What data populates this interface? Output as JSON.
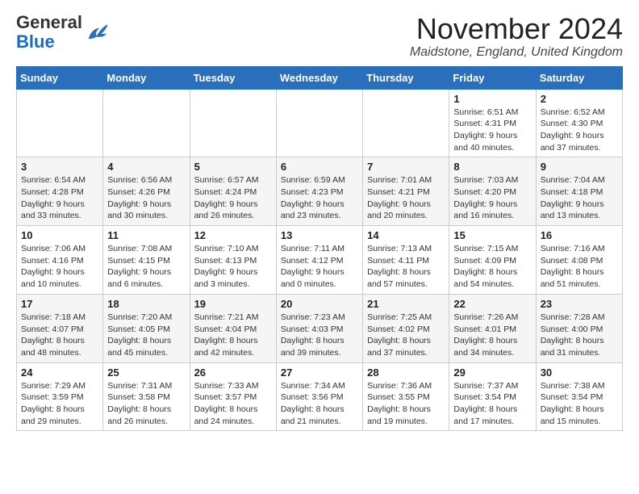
{
  "logo": {
    "general": "General",
    "blue": "Blue"
  },
  "title": "November 2024",
  "subtitle": "Maidstone, England, United Kingdom",
  "days_of_week": [
    "Sunday",
    "Monday",
    "Tuesday",
    "Wednesday",
    "Thursday",
    "Friday",
    "Saturday"
  ],
  "weeks": [
    [
      {
        "day": "",
        "info": ""
      },
      {
        "day": "",
        "info": ""
      },
      {
        "day": "",
        "info": ""
      },
      {
        "day": "",
        "info": ""
      },
      {
        "day": "",
        "info": ""
      },
      {
        "day": "1",
        "info": "Sunrise: 6:51 AM\nSunset: 4:31 PM\nDaylight: 9 hours and 40 minutes."
      },
      {
        "day": "2",
        "info": "Sunrise: 6:52 AM\nSunset: 4:30 PM\nDaylight: 9 hours and 37 minutes."
      }
    ],
    [
      {
        "day": "3",
        "info": "Sunrise: 6:54 AM\nSunset: 4:28 PM\nDaylight: 9 hours and 33 minutes."
      },
      {
        "day": "4",
        "info": "Sunrise: 6:56 AM\nSunset: 4:26 PM\nDaylight: 9 hours and 30 minutes."
      },
      {
        "day": "5",
        "info": "Sunrise: 6:57 AM\nSunset: 4:24 PM\nDaylight: 9 hours and 26 minutes."
      },
      {
        "day": "6",
        "info": "Sunrise: 6:59 AM\nSunset: 4:23 PM\nDaylight: 9 hours and 23 minutes."
      },
      {
        "day": "7",
        "info": "Sunrise: 7:01 AM\nSunset: 4:21 PM\nDaylight: 9 hours and 20 minutes."
      },
      {
        "day": "8",
        "info": "Sunrise: 7:03 AM\nSunset: 4:20 PM\nDaylight: 9 hours and 16 minutes."
      },
      {
        "day": "9",
        "info": "Sunrise: 7:04 AM\nSunset: 4:18 PM\nDaylight: 9 hours and 13 minutes."
      }
    ],
    [
      {
        "day": "10",
        "info": "Sunrise: 7:06 AM\nSunset: 4:16 PM\nDaylight: 9 hours and 10 minutes."
      },
      {
        "day": "11",
        "info": "Sunrise: 7:08 AM\nSunset: 4:15 PM\nDaylight: 9 hours and 6 minutes."
      },
      {
        "day": "12",
        "info": "Sunrise: 7:10 AM\nSunset: 4:13 PM\nDaylight: 9 hours and 3 minutes."
      },
      {
        "day": "13",
        "info": "Sunrise: 7:11 AM\nSunset: 4:12 PM\nDaylight: 9 hours and 0 minutes."
      },
      {
        "day": "14",
        "info": "Sunrise: 7:13 AM\nSunset: 4:11 PM\nDaylight: 8 hours and 57 minutes."
      },
      {
        "day": "15",
        "info": "Sunrise: 7:15 AM\nSunset: 4:09 PM\nDaylight: 8 hours and 54 minutes."
      },
      {
        "day": "16",
        "info": "Sunrise: 7:16 AM\nSunset: 4:08 PM\nDaylight: 8 hours and 51 minutes."
      }
    ],
    [
      {
        "day": "17",
        "info": "Sunrise: 7:18 AM\nSunset: 4:07 PM\nDaylight: 8 hours and 48 minutes."
      },
      {
        "day": "18",
        "info": "Sunrise: 7:20 AM\nSunset: 4:05 PM\nDaylight: 8 hours and 45 minutes."
      },
      {
        "day": "19",
        "info": "Sunrise: 7:21 AM\nSunset: 4:04 PM\nDaylight: 8 hours and 42 minutes."
      },
      {
        "day": "20",
        "info": "Sunrise: 7:23 AM\nSunset: 4:03 PM\nDaylight: 8 hours and 39 minutes."
      },
      {
        "day": "21",
        "info": "Sunrise: 7:25 AM\nSunset: 4:02 PM\nDaylight: 8 hours and 37 minutes."
      },
      {
        "day": "22",
        "info": "Sunrise: 7:26 AM\nSunset: 4:01 PM\nDaylight: 8 hours and 34 minutes."
      },
      {
        "day": "23",
        "info": "Sunrise: 7:28 AM\nSunset: 4:00 PM\nDaylight: 8 hours and 31 minutes."
      }
    ],
    [
      {
        "day": "24",
        "info": "Sunrise: 7:29 AM\nSunset: 3:59 PM\nDaylight: 8 hours and 29 minutes."
      },
      {
        "day": "25",
        "info": "Sunrise: 7:31 AM\nSunset: 3:58 PM\nDaylight: 8 hours and 26 minutes."
      },
      {
        "day": "26",
        "info": "Sunrise: 7:33 AM\nSunset: 3:57 PM\nDaylight: 8 hours and 24 minutes."
      },
      {
        "day": "27",
        "info": "Sunrise: 7:34 AM\nSunset: 3:56 PM\nDaylight: 8 hours and 21 minutes."
      },
      {
        "day": "28",
        "info": "Sunrise: 7:36 AM\nSunset: 3:55 PM\nDaylight: 8 hours and 19 minutes."
      },
      {
        "day": "29",
        "info": "Sunrise: 7:37 AM\nSunset: 3:54 PM\nDaylight: 8 hours and 17 minutes."
      },
      {
        "day": "30",
        "info": "Sunrise: 7:38 AM\nSunset: 3:54 PM\nDaylight: 8 hours and 15 minutes."
      }
    ]
  ]
}
